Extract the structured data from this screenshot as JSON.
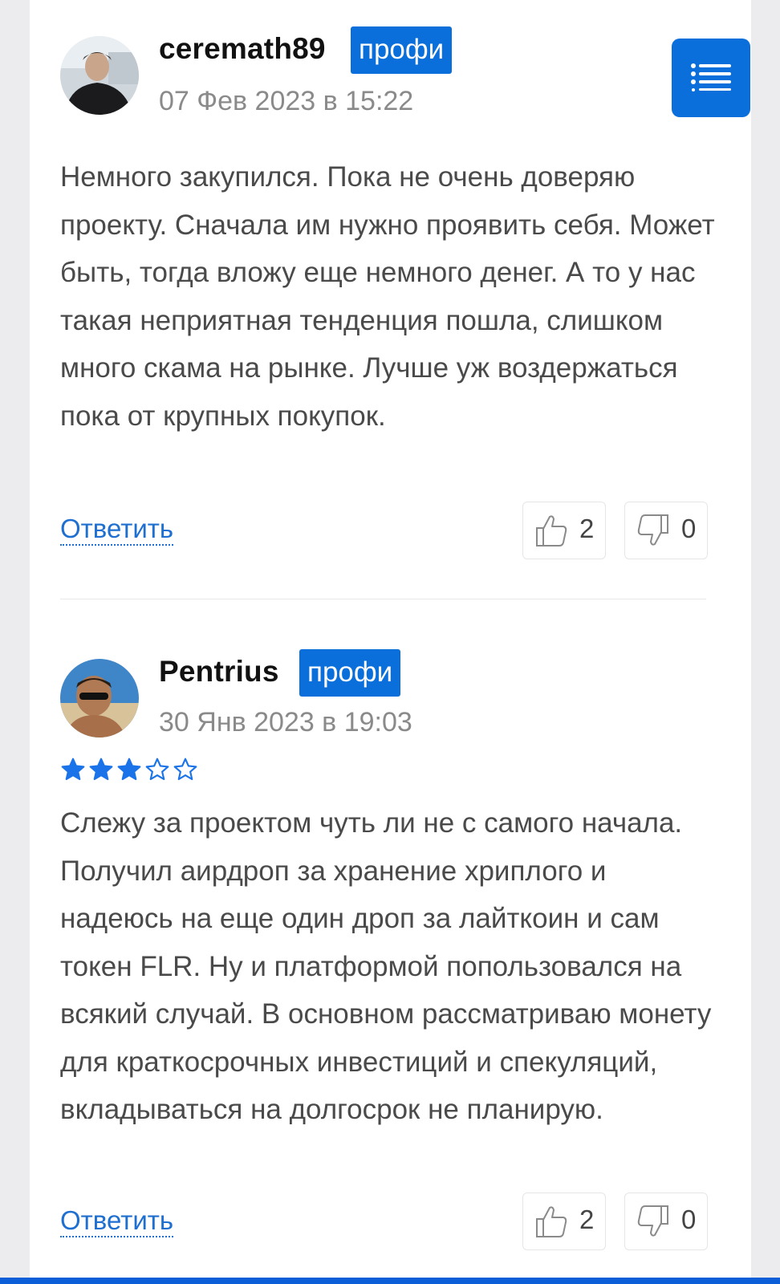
{
  "colors": {
    "accent": "#0a6fdb",
    "badge_text": "#ffffff",
    "body_text": "#4a4a4a",
    "muted": "#8a8a8a",
    "link": "#1f6fd0",
    "star": "#1a73e8"
  },
  "menu": {
    "icon": "list-icon"
  },
  "comments": [
    {
      "username": "ceremath89",
      "badge": "профи",
      "date": "07 Фев 2023 в 15:22",
      "rating": null,
      "text": "Немного закупился. Пока не очень доверяю проекту. Сначала им нужно проявить себя. Может быть, тогда вложу еще немного денег. А то у нас такая неприятная тенденция пошла, слишком много скама на рынке. Лучше уж воздержаться пока от крупных покупок.",
      "reply_label": "Ответить",
      "likes": "2",
      "dislikes": "0"
    },
    {
      "username": "Pentrius",
      "badge": "профи",
      "date": "30 Янв 2023 в 19:03",
      "rating": {
        "value": 3,
        "max": 5
      },
      "text": "Слежу за проектом чуть ли не с самого начала. Получил аирдроп за хранение хриплого и надеюсь на еще один дроп за лайткоин и сам токен FLR. Ну и платформой попользовался на всякий случай. В основном рассматриваю монету для краткосрочных инвестиций и спекуляций, вкладываться на долгосрок не планирую.",
      "reply_label": "Ответить",
      "likes": "2",
      "dislikes": "0"
    }
  ]
}
